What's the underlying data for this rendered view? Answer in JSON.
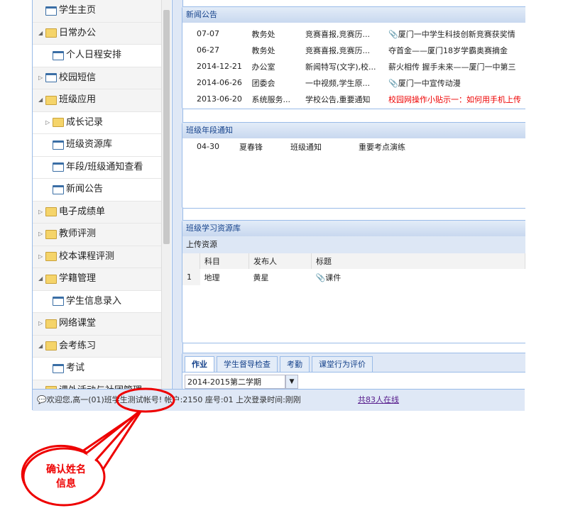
{
  "sidebar": {
    "items": [
      {
        "label": "学生主页",
        "icon": "page-icon"
      },
      {
        "label": "日常办公",
        "icon": "calendar-folder-icon",
        "expanded": true
      },
      {
        "label": "个人日程安排",
        "icon": "page-icon"
      },
      {
        "label": "校园短信",
        "icon": "message-icon"
      },
      {
        "label": "班级应用",
        "icon": "folder-icon",
        "expanded": true
      },
      {
        "label": "成长记录",
        "icon": "folder-icon"
      },
      {
        "label": "班级资源库",
        "icon": "page-icon"
      },
      {
        "label": "年段/班级通知查看",
        "icon": "page-icon"
      },
      {
        "label": "新闻公告",
        "icon": "page-icon"
      },
      {
        "label": "电子成绩单",
        "icon": "folder-icon"
      },
      {
        "label": "教师评测",
        "icon": "folder-icon"
      },
      {
        "label": "校本课程评测",
        "icon": "folder-icon"
      },
      {
        "label": "学籍管理",
        "icon": "folder-icon",
        "expanded": true
      },
      {
        "label": "学生信息录入",
        "icon": "page-icon"
      },
      {
        "label": "网络课堂",
        "icon": "folder-icon"
      },
      {
        "label": "会考练习",
        "icon": "folder-icon",
        "expanded": true
      },
      {
        "label": "考试",
        "icon": "page-icon"
      },
      {
        "label": "课外活动与社团管理",
        "icon": "folder-icon"
      }
    ]
  },
  "news": {
    "title": "新闻公告",
    "rows": [
      {
        "date": "07-07",
        "dept": "教务处",
        "cat": "竞赛喜报,竞赛历...",
        "title": "厦门一中学生科技创新竞赛获奖情",
        "attach": true
      },
      {
        "date": "06-27",
        "dept": "教务处",
        "cat": "竞赛喜报,竞赛历...",
        "title": "夺首金——厦门18岁学霸奥赛摘金"
      },
      {
        "date": "2014-12-21",
        "dept": "办公室",
        "cat": "新闻特写(文字),校...",
        "title": "薪火相传 握手未来——厦门一中第三"
      },
      {
        "date": "2014-06-26",
        "dept": "团委会",
        "cat": "一中视频,学生原...",
        "title": "厦门一中宣传动漫",
        "attach": true
      },
      {
        "date": "2013-06-20",
        "dept": "系统服务...",
        "cat": "学校公告,重要通知",
        "title": "校园网操作小贴示一：如何用手机上传",
        "red": true
      }
    ]
  },
  "notice": {
    "title": "班级年段通知",
    "rows": [
      {
        "date": "04-30",
        "person": "夏春锋",
        "type": "班级通知",
        "title": "重要考点演练"
      }
    ]
  },
  "resources": {
    "title": "班级学习资源库",
    "sub": "上传资源",
    "headers": [
      "科目",
      "发布人",
      "标题"
    ],
    "rows": [
      {
        "num": "1",
        "subject": "地理",
        "publisher": "黄星",
        "title": "课件"
      }
    ]
  },
  "tabs": [
    "作业",
    "学生督导检查",
    "考勤",
    "课堂行为评价"
  ],
  "term_select": "2014-2015第二学期",
  "status": {
    "welcome": "欢迎您,高一(01)班学生测试帐号! 帐户:2150 座号:01 上次登录时间:刚刚",
    "online": "共83人在线"
  },
  "callout": "确认姓名信息",
  "colors": {
    "accent": "#15428b",
    "highlight": "#e00000"
  }
}
